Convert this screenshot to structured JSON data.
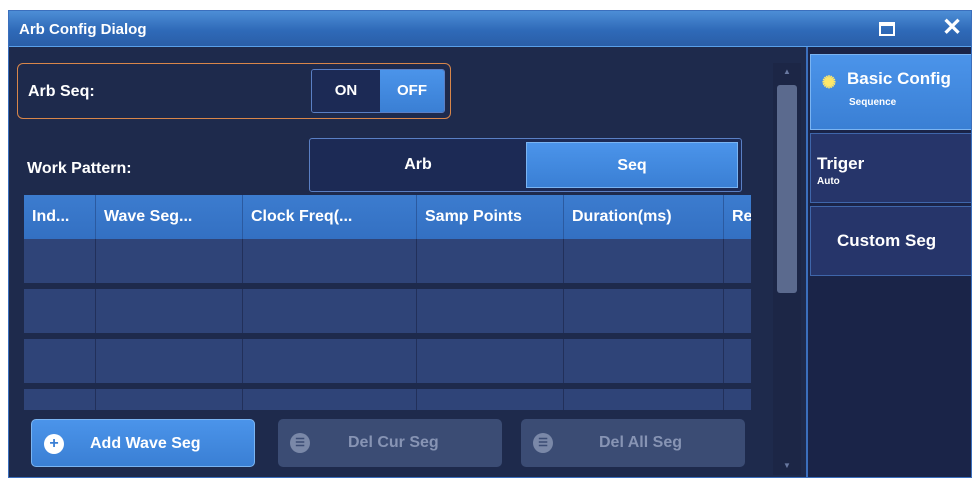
{
  "window": {
    "title": "Arb Config Dialog"
  },
  "titlebar": {
    "maximize_icon": "maximize-icon",
    "close_symbol": "✕"
  },
  "arb_seq": {
    "label": "Arb Seq:",
    "on_label": "ON",
    "off_label": "OFF",
    "selected": "OFF"
  },
  "work_pattern": {
    "label": "Work Pattern:",
    "options": [
      "Arb",
      "Seq"
    ],
    "selected": "Seq"
  },
  "table": {
    "columns": [
      "Ind...",
      "Wave Seg...",
      "Clock Freq(...",
      "Samp Points",
      "Duration(ms)",
      "Re"
    ],
    "rows": []
  },
  "buttons": {
    "add": {
      "label": "Add Wave Seg",
      "icon": "+",
      "enabled": true
    },
    "del_cur": {
      "label": "Del Cur Seg",
      "icon": "☰",
      "enabled": false
    },
    "del_all": {
      "label": "Del All Seg",
      "icon": "☰",
      "enabled": false
    }
  },
  "side_tabs": [
    {
      "title": "Basic Config",
      "subtitle": "Sequence",
      "icon": "✺",
      "active": true
    },
    {
      "title": "Triger",
      "subtitle": "Auto",
      "active": false
    },
    {
      "title": "Custom Seg",
      "subtitle": "",
      "active": false
    }
  ],
  "scrollbar": {
    "up_arrow": "▲",
    "down_arrow": "▼"
  },
  "colors": {
    "accent": "#3a7fd4",
    "background": "#1e2a4c",
    "toggle_outline": "#d8864a",
    "disabled": "#3b4c74"
  }
}
